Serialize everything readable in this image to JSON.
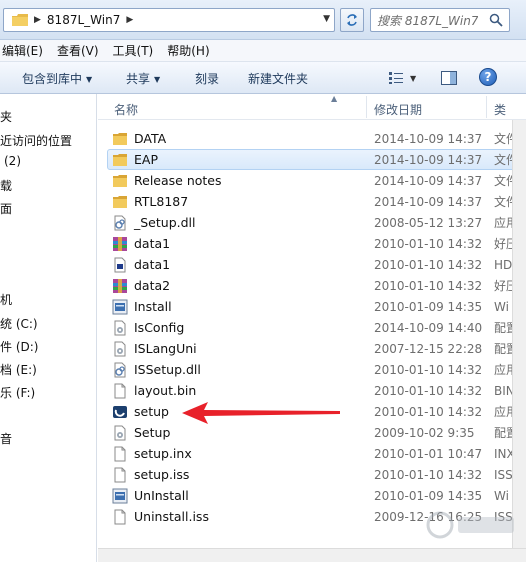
{
  "address": {
    "path": "8187L_Win7",
    "search_placeholder": "搜索 8187L_Win7"
  },
  "menu": [
    "编辑(E)",
    "查看(V)",
    "工具(T)",
    "帮助(H)"
  ],
  "commands": {
    "include_library": "包含到库中",
    "share": "共享",
    "burn": "刻录",
    "new_folder": "新建文件夹",
    "help": "?"
  },
  "nav": {
    "items": [
      "夹",
      "近访问的位置",
      "(2)",
      "载",
      "面",
      "机",
      "统 (C:)",
      "件 (D:)",
      "档 (E:)",
      "乐 (F:)",
      "音"
    ]
  },
  "columns": {
    "name": "名称",
    "modified": "修改日期",
    "type": "类"
  },
  "files": [
    {
      "name": "DATA",
      "date": "2014-10-09 14:37",
      "type": "文件",
      "icon": "folder-icon"
    },
    {
      "name": "EAP",
      "date": "2014-10-09 14:37",
      "type": "文件",
      "icon": "folder-icon"
    },
    {
      "name": "Release notes",
      "date": "2014-10-09 14:37",
      "type": "文件",
      "icon": "folder-icon"
    },
    {
      "name": "RTL8187",
      "date": "2014-10-09 14:37",
      "type": "文件",
      "icon": "folder-icon"
    },
    {
      "name": "_Setup.dll",
      "date": "2008-05-12 13:27",
      "type": "应用",
      "icon": "dll-icon"
    },
    {
      "name": "data1",
      "date": "2010-01-10 14:32",
      "type": "好压",
      "icon": "archive-icon"
    },
    {
      "name": "data1",
      "date": "2010-01-10 14:32",
      "type": "HD",
      "icon": "hdr-file-icon"
    },
    {
      "name": "data2",
      "date": "2010-01-10 14:32",
      "type": "好压",
      "icon": "archive-icon"
    },
    {
      "name": "Install",
      "date": "2010-01-09 14:35",
      "type": "Wi",
      "icon": "installer-icon"
    },
    {
      "name": "IsConfig",
      "date": "2014-10-09 14:40",
      "type": "配置",
      "icon": "config-icon"
    },
    {
      "name": "ISLangUni",
      "date": "2007-12-15 22:28",
      "type": "配置",
      "icon": "config-icon"
    },
    {
      "name": "ISSetup.dll",
      "date": "2010-01-10 14:32",
      "type": "应用",
      "icon": "dll-icon"
    },
    {
      "name": "layout.bin",
      "date": "2010-01-10 14:32",
      "type": "BIN",
      "icon": "blank-file-icon"
    },
    {
      "name": "setup",
      "date": "2010-01-10 14:32",
      "type": "应用",
      "icon": "setup-exe-icon"
    },
    {
      "name": "Setup",
      "date": "2009-10-02 9:35",
      "type": "配置",
      "icon": "config-icon"
    },
    {
      "name": "setup.inx",
      "date": "2010-01-01 10:47",
      "type": "INX",
      "icon": "blank-file-icon"
    },
    {
      "name": "setup.iss",
      "date": "2010-01-10 14:32",
      "type": "ISS",
      "icon": "blank-file-icon"
    },
    {
      "name": "UnInstall",
      "date": "2010-01-09 14:35",
      "type": "Wi",
      "icon": "installer-icon"
    },
    {
      "name": "Uninstall.iss",
      "date": "2009-12-16 16:25",
      "type": "ISS",
      "icon": "blank-file-icon"
    }
  ],
  "selected_index": 1,
  "colors": {
    "accent": "#e8212a",
    "selection": "#d9e9fb"
  }
}
